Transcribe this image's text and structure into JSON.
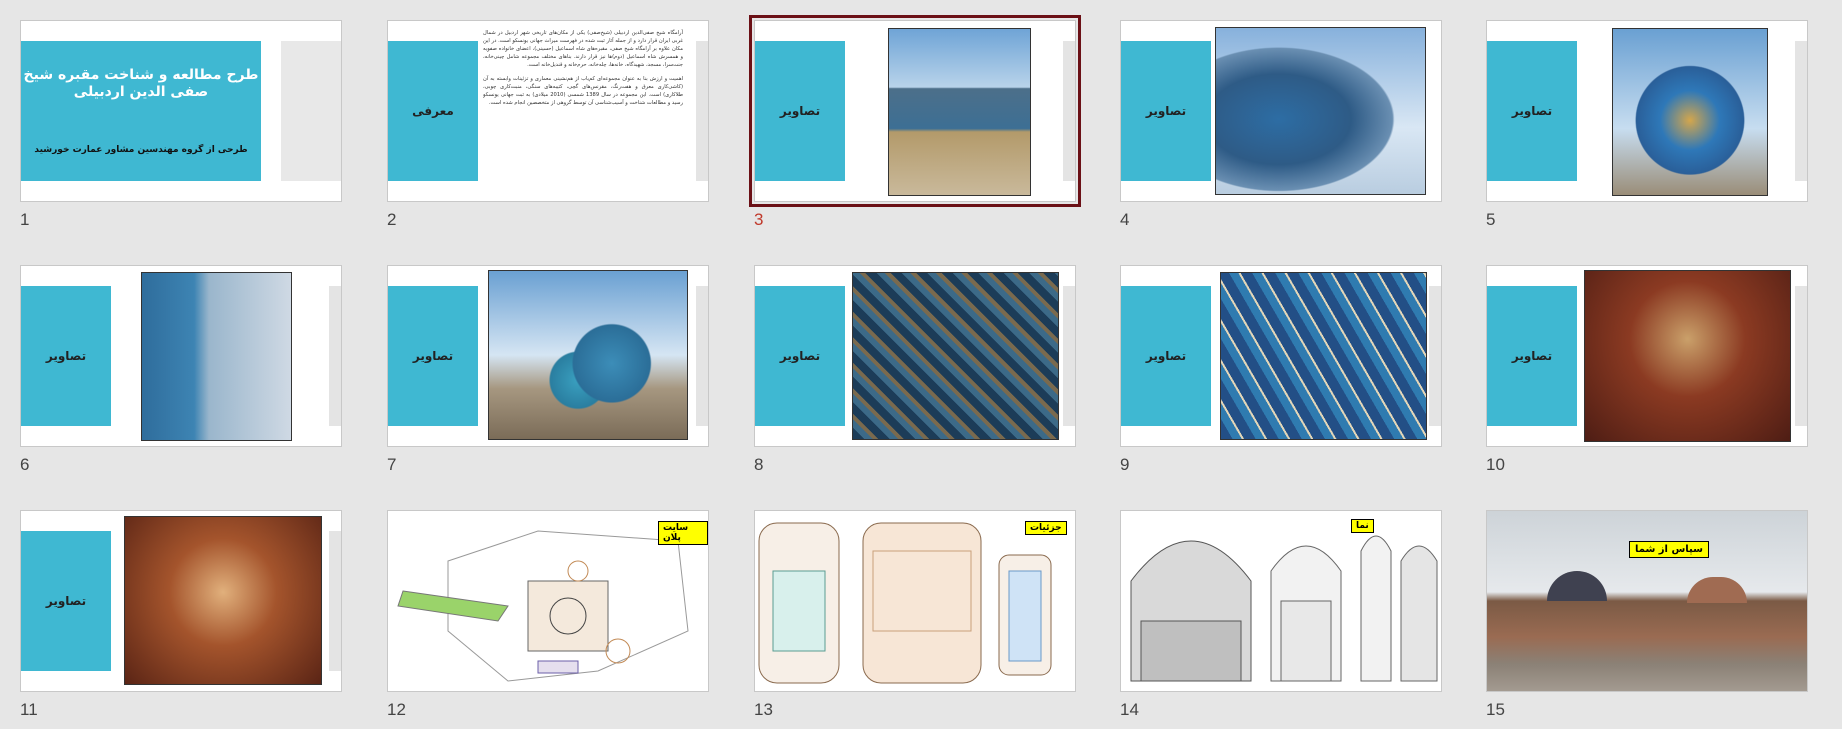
{
  "slides": [
    {
      "number": "1",
      "title": "طرح مطالعه و شناخت مقبره شیخ صفی الدین اردبیلی",
      "subtitle": "طرحی از گروه مهندسین مشاور عمارت خورشید"
    },
    {
      "number": "2",
      "label": "معرفی",
      "text_1": "آرامگاه شیخ صفی‌الدین اردبیلی (شیخ‌صفی) یکی از مکان‌های تاریخی شهر اردبیل در شمال غربی ایران قرار دارد و از جمله آثار ثبت شده در فهرست میراث جهانی یونسکو است. در این مکان علاوه بر آرامگاه شیخ صفی، مقبره‌های شاه اسماعیل (حسینی)، اعضای خانواده صفویه و همسرش شاه اسماعیل (دوم)ها نیز قرار دارند. بناهای مختلف مجموعه شامل چینی‌خانه، جنت‌سرا، مسجد، شهیدگاه، خانه‌ها، چله‌خانه، حرم‌خانه و قندیل‌خانه است.",
      "text_2": "اهمیت و ارزش بنا به عنوان مجموعه‌ای کم‌یاب از هم‌نشینی معماری و تزئینات وابسته به آن (کاشی‌کاری معرق و هفت‌رنگ، مقرنس‌های گچی، کتیبه‌های سنگی، منبت‌کاری چوبی، طلاکاری) است. این مجموعه در سال 1389 شمسی (2010 میلادی) به ثبت جهانی یونسکو رسید و مطالعات شناخت و آسیب‌شناسی آن توسط گروهی از متخصصین انجام شده است."
    },
    {
      "number": "3",
      "label": "تصاویر"
    },
    {
      "number": "4",
      "label": "تصاویر"
    },
    {
      "number": "5",
      "label": "تصاویر"
    },
    {
      "number": "6",
      "label": "تصاویر"
    },
    {
      "number": "7",
      "label": "تصاویر"
    },
    {
      "number": "8",
      "label": "تصاویر"
    },
    {
      "number": "9",
      "label": "تصاویر"
    },
    {
      "number": "10",
      "label": "تصاویر"
    },
    {
      "number": "11",
      "label": "تصاویر"
    },
    {
      "number": "12",
      "tag": "سایت پلان"
    },
    {
      "number": "13",
      "tag": "جزئیات"
    },
    {
      "number": "14",
      "tag": "نما"
    },
    {
      "number": "15",
      "tag": "سپاس از شما"
    }
  ],
  "selected_slide": "3",
  "colors": {
    "accent": "#3fb8d2",
    "selection": "#6b1016",
    "selected_number": "#c0392b",
    "background": "#e6e6e6"
  }
}
